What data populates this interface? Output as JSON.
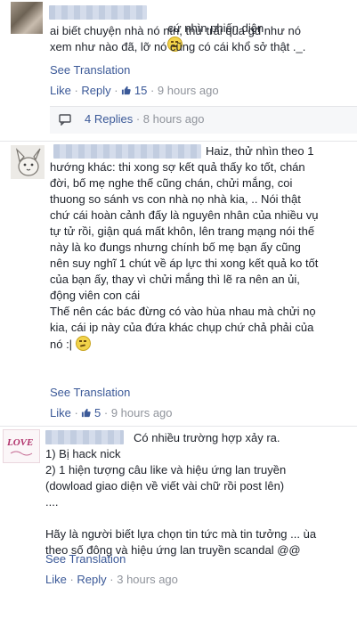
{
  "comments": [
    {
      "text": "cứ nhìn phiến diện",
      "body": "ai biết chuyện nhà nó ntn, thử trải qua gđ như nó\nxem như nào đã, lỡ nó cũng có cái khổ sở thật ._.",
      "see_translation": "See Translation",
      "like": "Like",
      "reply": "Reply",
      "likes_count": "15",
      "time": "9 hours ago",
      "replies_label": "4 Replies",
      "replies_time": "8 hours ago"
    },
    {
      "text_first": "Haiz, thử nhìn theo 1",
      "body": "hướng khác: thi xong sợ kết quả thấy ko tốt, chán\nđời, bố mẹ nghe thế cũng chán, chửi mắng, coi\nthuong so sánh vs con nhà nọ nhà kia, .. Nói thật\nchứ cái hoàn cảnh đấy là nguyên nhân của nhiều vụ\ntự tử rồi, giận quá mất khôn, lên trang mạng nói thế\nnày là ko đungs nhưng chính bố mẹ bạn ấy cũng\nnên suy nghĩ 1 chút về áp lực thi xong kết quả ko tốt\ncủa bạn ấy, thay vì chửi mắng thì lẽ ra nên an ủi,\nđộng viên con cái\nThế nên các bác đừng có vào hùa nhau mà chửi nọ\nkia, cái ip này của đứa khác chụp chứ chả phải của\nnó :|",
      "see_translation": "See Translation",
      "like": "Like",
      "likes_count": "5",
      "time": "9 hours ago"
    },
    {
      "avatar_text": "LOVE",
      "text_first": "Có nhiều trường hợp xảy ra.",
      "body": "1) Bị hack nick\n2) 1 hiện tượng câu like và hiệu ứng lan truyền\n(dowload giao diện về viết vài chữ rồi post lên)\n....\n\nHãy là người biết lựa chọn tin tức mà tin tưởng ... ùa\ntheo số đông và hiệu ứng lan truyền scandal @@",
      "see_translation": "See Translation",
      "like": "Like",
      "reply": "Reply",
      "time": "3 hours ago"
    }
  ],
  "icons": {
    "emoji_1": "neutral-face-icon",
    "emoji_2": "smirk-face-icon",
    "like_thumb": "thumbs-up-icon",
    "replies": "reply-arrow-icon"
  },
  "colors": {
    "link": "#3b5998",
    "meta_grey": "#90949c",
    "text": "#1d2129",
    "replies_bg": "#f6f7f9"
  }
}
